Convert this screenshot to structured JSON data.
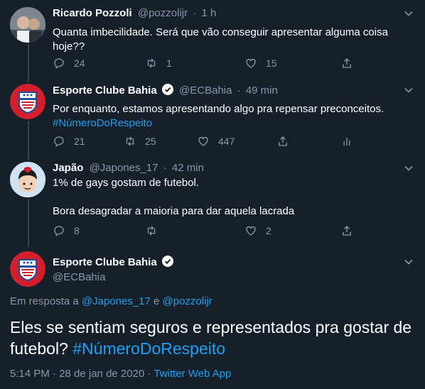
{
  "tweets": [
    {
      "name": "Ricardo Pozzoli",
      "handle": "@pozzolijr",
      "time": "1 h",
      "text": "Quanta imbecilidade. Será que vão conseguir apresentar alguma coisa hoje??",
      "replies": "24",
      "retweets": "1",
      "likes": "15"
    },
    {
      "name": "Esporte Clube Bahia",
      "handle": "@ECBahia",
      "time": "49 min",
      "text": "Por enquanto, estamos apresentando algo pra repensar preconceitos.",
      "hashtag": "#NúmeroDoRespeito",
      "replies": "21",
      "retweets": "25",
      "likes": "447"
    },
    {
      "name": "Japão",
      "handle": "@Japones_17",
      "time": "42 min",
      "text_line1": "1% de gays gostam de futebol.",
      "text_line2": "Bora desagradar a maioria para dar aquela lacrada",
      "replies": "8",
      "likes": "2"
    }
  ],
  "main_tweet": {
    "name": "Esporte Clube Bahia",
    "handle": "@ECBahia",
    "reply_prefix": "Em resposta a",
    "reply_to_1": "@Japones_17",
    "reply_joiner": "e",
    "reply_to_2": "@pozzolijr",
    "text": "Eles se sentiam seguros e representados pra gostar de futebol?",
    "hashtag": "#NúmeroDoRespeito",
    "timestamp": "5:14 PM · 28 de jan de 2020 ·",
    "source": "Twitter Web App"
  },
  "separator": "·",
  "colors": {
    "background": "#15202b",
    "accent": "#1da1f2",
    "muted": "#8899a6",
    "thread_line": "#38444d",
    "bahia_red": "#d21f2b",
    "bahia_blue": "#1f4e9c"
  }
}
